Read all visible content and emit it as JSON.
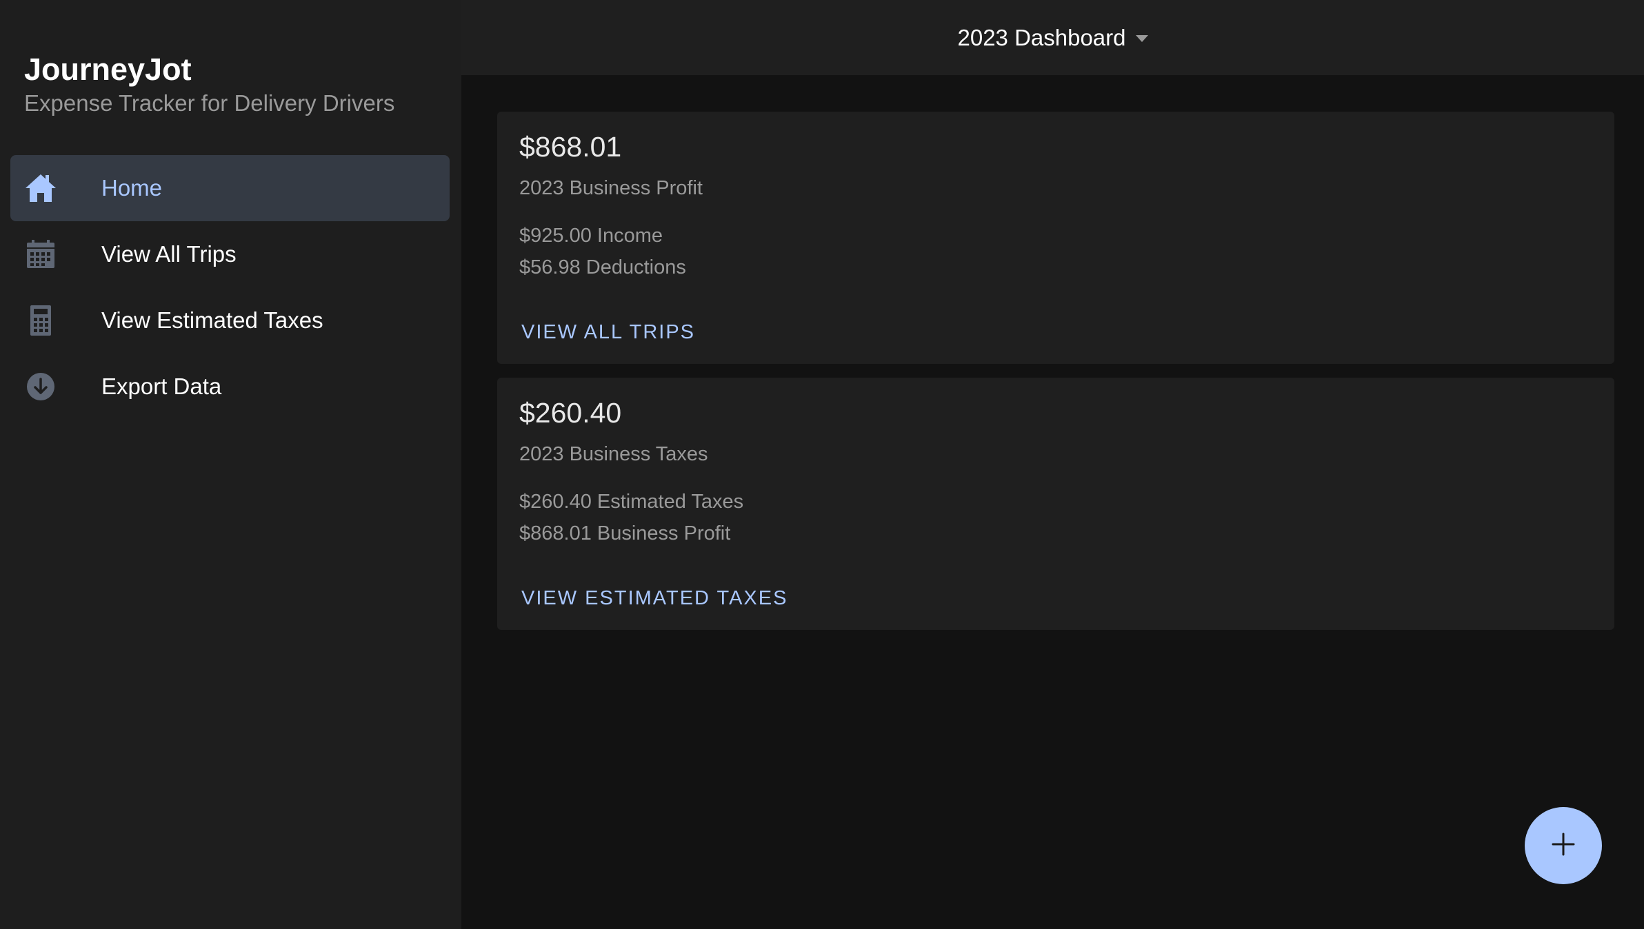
{
  "app": {
    "title": "JourneyJot",
    "subtitle": "Expense Tracker for Delivery Drivers"
  },
  "sidebar": {
    "items": [
      {
        "label": "Home",
        "icon": "home-icon",
        "active": true
      },
      {
        "label": "View All Trips",
        "icon": "calendar-icon",
        "active": false
      },
      {
        "label": "View Estimated Taxes",
        "icon": "calculator-icon",
        "active": false
      },
      {
        "label": "Export Data",
        "icon": "download-circle-icon",
        "active": false
      }
    ]
  },
  "header": {
    "dashboard_label": "2023 Dashboard",
    "dropdown_icon": "caret-down-icon"
  },
  "cards": [
    {
      "amount": "$868.01",
      "caption": "2023 Business Profit",
      "lines": [
        "$925.00 Income",
        "$56.98 Deductions"
      ],
      "action": "VIEW ALL TRIPS"
    },
    {
      "amount": "$260.40",
      "caption": "2023 Business Taxes",
      "lines": [
        "$260.40 Estimated Taxes",
        "$868.01 Business Profit"
      ],
      "action": "VIEW ESTIMATED TAXES"
    }
  ],
  "fab": {
    "icon": "plus-icon"
  },
  "colors": {
    "accent": "#a9c7ff",
    "sidebar_bg": "#1e1e1e",
    "main_bg": "#121212",
    "card_bg": "#1f1f1f",
    "active_item_bg": "#343a44",
    "muted_text": "#9a9a9a",
    "icon_gray": "#5f6775"
  }
}
